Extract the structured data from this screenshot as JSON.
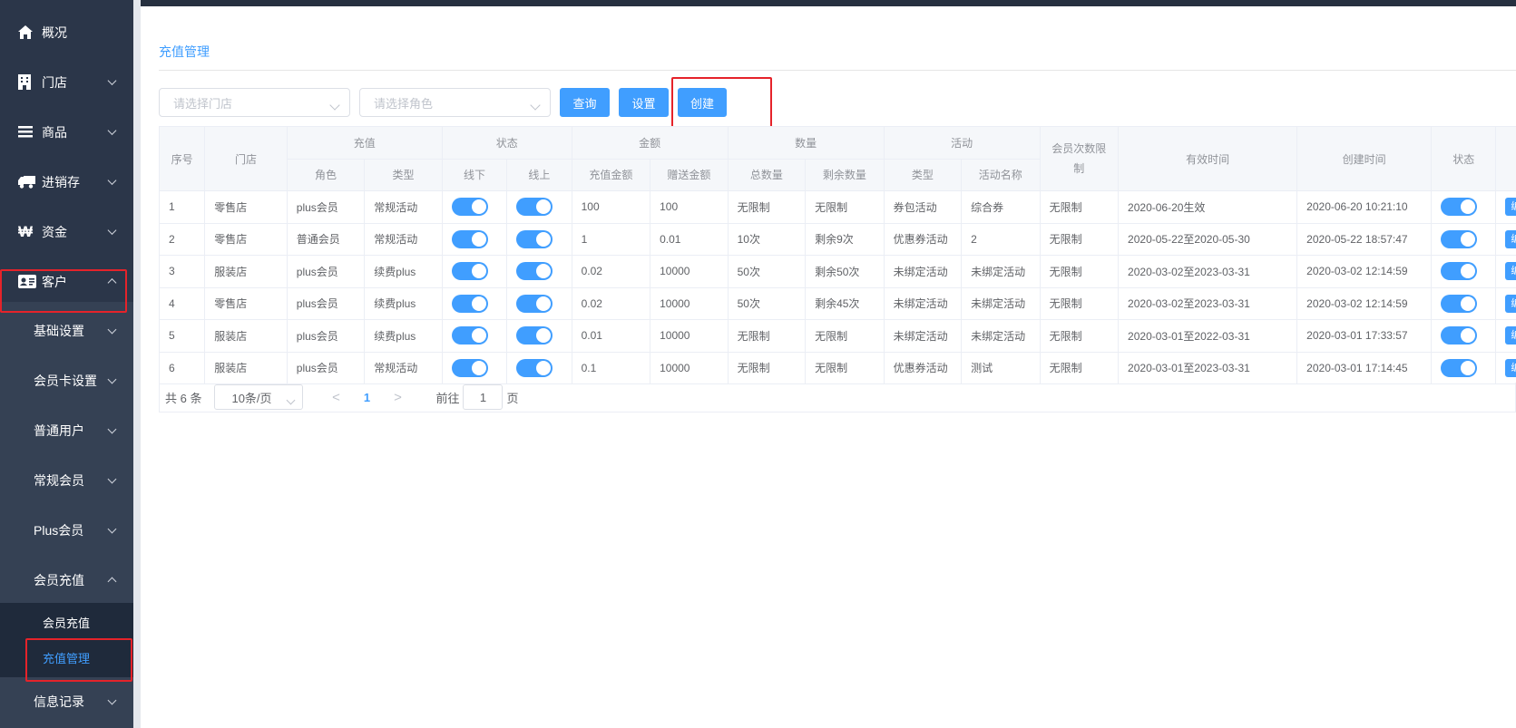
{
  "sidebar": {
    "items": [
      {
        "label": "概况",
        "icon": "home-icon"
      },
      {
        "label": "门店",
        "icon": "building-icon"
      },
      {
        "label": "商品",
        "icon": "menu-icon"
      },
      {
        "label": "进销存",
        "icon": "truck-icon"
      },
      {
        "label": "资金",
        "icon": "won-icon"
      },
      {
        "label": "客户",
        "icon": "id-card-icon"
      }
    ],
    "customer_sub": [
      {
        "label": "基础设置"
      },
      {
        "label": "会员卡设置"
      },
      {
        "label": "普通用户"
      },
      {
        "label": "常规会员"
      },
      {
        "label": "Plus会员"
      },
      {
        "label": "会员充值"
      }
    ],
    "recharge_sub": [
      {
        "label": "会员充值"
      },
      {
        "label": "充值管理"
      }
    ],
    "info_log": {
      "label": "信息记录"
    }
  },
  "page": {
    "title": "充值管理"
  },
  "filters": {
    "store_placeholder": "请选择门店",
    "role_placeholder": "请选择角色",
    "query_label": "查询",
    "settings_label": "设置",
    "create_label": "创建"
  },
  "table": {
    "head1": {
      "index": "序号",
      "store": "门店",
      "recharge": "充值",
      "status": "状态",
      "amount": "金额",
      "quantity": "数量",
      "activity": "活动",
      "member_limit": "会员次数限制",
      "valid_time": "有效时间",
      "created_time": "创建时间",
      "row_status": "状态"
    },
    "head2": {
      "role": "角色",
      "type": "类型",
      "offline": "线下",
      "online": "线上",
      "recharge_amount": "充值金额",
      "bonus_amount": "赠送金额",
      "total_qty": "总数量",
      "remain_qty": "剩余数量",
      "activity_type": "类型",
      "activity_name": "活动名称"
    },
    "edit_label": "编辑",
    "rows": [
      {
        "index": "1",
        "store": "零售店",
        "role": "plus会员",
        "type": "常规活动",
        "recharge": "100",
        "bonus": "100",
        "total": "无限制",
        "remain": "无限制",
        "act_type": "券包活动",
        "act_name": "综合券",
        "limit": "无限制",
        "valid": "2020-06-20生效",
        "created": "2020-06-20 10:21:10"
      },
      {
        "index": "2",
        "store": "零售店",
        "role": "普通会员",
        "type": "常规活动",
        "recharge": "1",
        "bonus": "0.01",
        "total": "10次",
        "remain": "剩余9次",
        "act_type": "优惠券活动",
        "act_name": "2",
        "limit": "无限制",
        "valid": "2020-05-22至2020-05-30",
        "created": "2020-05-22 18:57:47"
      },
      {
        "index": "3",
        "store": "服装店",
        "role": "plus会员",
        "type": "续费plus",
        "recharge": "0.02",
        "bonus": "10000",
        "total": "50次",
        "remain": "剩余50次",
        "act_type": "未绑定活动",
        "act_name": "未绑定活动",
        "limit": "无限制",
        "valid": "2020-03-02至2023-03-31",
        "created": "2020-03-02 12:14:59"
      },
      {
        "index": "4",
        "store": "零售店",
        "role": "plus会员",
        "type": "续费plus",
        "recharge": "0.02",
        "bonus": "10000",
        "total": "50次",
        "remain": "剩余45次",
        "act_type": "未绑定活动",
        "act_name": "未绑定活动",
        "limit": "无限制",
        "valid": "2020-03-02至2023-03-31",
        "created": "2020-03-02 12:14:59"
      },
      {
        "index": "5",
        "store": "服装店",
        "role": "plus会员",
        "type": "续费plus",
        "recharge": "0.01",
        "bonus": "10000",
        "total": "无限制",
        "remain": "无限制",
        "act_type": "未绑定活动",
        "act_name": "未绑定活动",
        "limit": "无限制",
        "valid": "2020-03-01至2022-03-31",
        "created": "2020-03-01 17:33:57"
      },
      {
        "index": "6",
        "store": "服装店",
        "role": "plus会员",
        "type": "常规活动",
        "recharge": "0.1",
        "bonus": "10000",
        "total": "无限制",
        "remain": "无限制",
        "act_type": "优惠券活动",
        "act_name": "测试",
        "limit": "无限制",
        "valid": "2020-03-01至2023-03-31",
        "created": "2020-03-01 17:14:45"
      }
    ]
  },
  "pagination": {
    "total": "共 6 条",
    "page_size": "10条/页",
    "prev": "<",
    "current": "1",
    "next": ">",
    "goto_prefix": "前往",
    "goto_value": "1",
    "goto_suffix": "页"
  },
  "colors": {
    "accent": "#409eff",
    "sidebar_bg": "#2b3649",
    "highlight_border": "#e5232a"
  }
}
